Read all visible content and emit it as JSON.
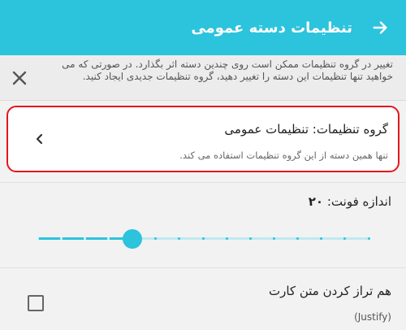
{
  "appbar": {
    "title": "تنظیمات دسته عمومی",
    "back_icon": "arrow-forward-icon",
    "color": "#2cc3dd"
  },
  "warning": {
    "text": "تغییر در گروه تنظیمات ممکن است روی چندین دسته اثر بگذارد. در صورتی که می خواهید تنها تنظیمات این دسته را تغییر دهید، گروه تنظیمات جدیدی ایجاد کنید.",
    "close_icon": "close-icon"
  },
  "settings_group": {
    "title": "گروه تنظیمات: تنظیمات عمومی",
    "subtitle": "تنها همین دسته از این گروه تنظیمات استفاده می کند.",
    "chevron_icon": "chevron-left-icon",
    "highlight_color": "#e8141c"
  },
  "font_size": {
    "label": "اندازه فونت: ",
    "value": "۲۰",
    "slider_fraction": 0.286,
    "steps": 15
  },
  "justify": {
    "title": "هم تراز کردن متن کارت",
    "subtitle": "(Justify)",
    "checked": false
  }
}
